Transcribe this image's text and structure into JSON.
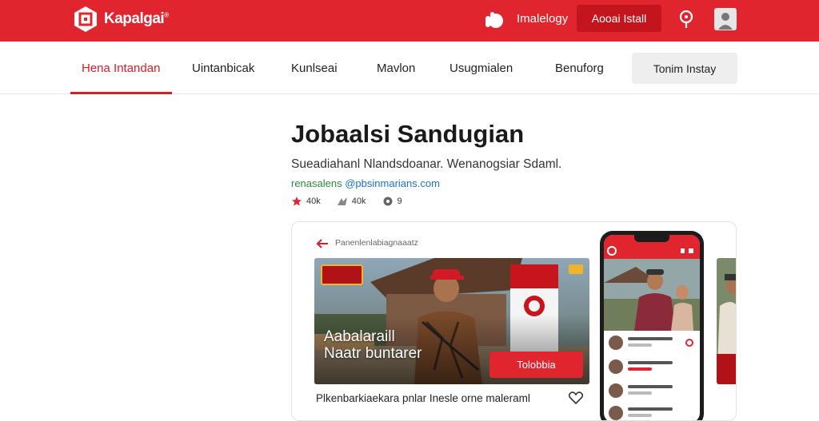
{
  "header": {
    "brand": "Kapalgai",
    "brand_mark": "®",
    "login_label": "Imalelogy",
    "install_label": "Aooai Istall",
    "icons": [
      "logo-icon",
      "bell-icon",
      "pin-icon",
      "avatar-icon"
    ],
    "bar_color": "#e1252f"
  },
  "nav": {
    "items": [
      {
        "label": "Hena Intandan",
        "active": true
      },
      {
        "label": "Uintanbicak"
      },
      {
        "label": "Kunlseai"
      },
      {
        "label": "Mavlon"
      },
      {
        "label": "Usugmialen"
      },
      {
        "label": "Benuforg"
      }
    ],
    "button_label": "Tonim Instay",
    "accent": "#d21f2a"
  },
  "profile": {
    "title": "Jobaalsi Sandugian",
    "subtitle": "Sueadiahanl Nlandsdoanar. Wenanogsiar Sdaml.",
    "handle_prefix": "renasalens",
    "handle_email": "@pbsinmarians.com",
    "stats": [
      {
        "icon": "star-icon",
        "value": "40k"
      },
      {
        "icon": "share-icon",
        "value": "40k"
      },
      {
        "icon": "comment-icon",
        "value": "9"
      }
    ]
  },
  "card": {
    "caption": "Panenlenlabiagnaaatz",
    "hero_title_line1": "Aabalaraill",
    "hero_title_line2": "Naatr buntarer",
    "hero_cta": "Tolobbia",
    "post_text": "Plkenbarkiaekara pnlar Inesle orne maleraml"
  }
}
